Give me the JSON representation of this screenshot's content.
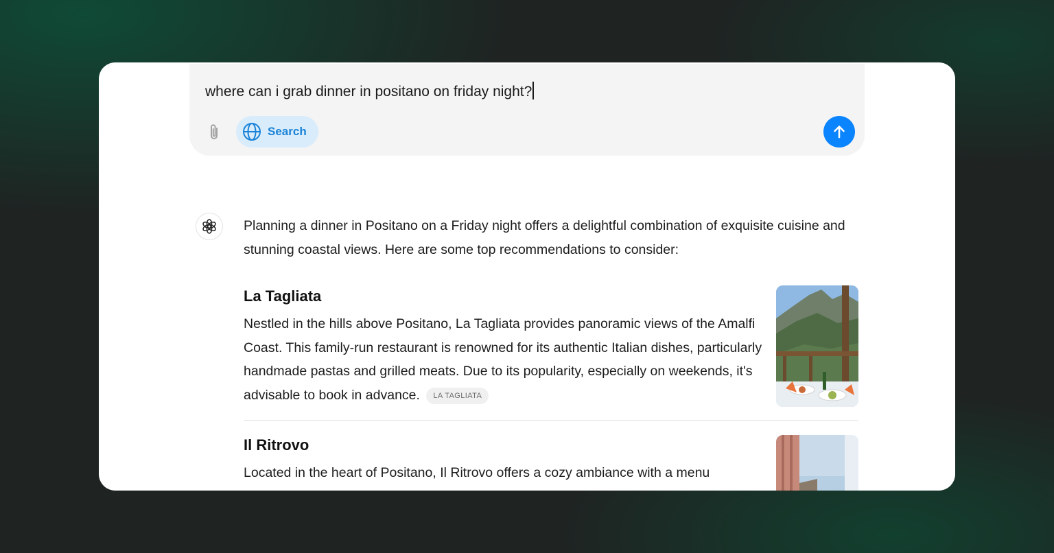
{
  "composer": {
    "query": "where can i grab dinner in positano on friday night?",
    "search_label": "Search"
  },
  "response": {
    "intro": "Planning a dinner in Positano on a Friday night offers a delightful combination of exquisite cuisine and stunning coastal views. Here are some top recommendations to consider:",
    "items": [
      {
        "title": "La Tagliata",
        "body": "Nestled in the hills above Positano, La Tagliata provides panoramic views of the Amalfi Coast. This family-run restaurant is renowned for its authentic Italian dishes, particularly handmade pastas and grilled meats. Due to its popularity, especially on weekends, it's advisable to book in advance.",
        "source": "LA TAGLIATA"
      },
      {
        "title": "Il Ritrovo",
        "body": "Located in the heart of Positano, Il Ritrovo offers a cozy ambiance with a menu"
      }
    ]
  },
  "colors": {
    "accent": "#0a84ff",
    "search_chip_bg": "#d9ecfb",
    "search_chip_text": "#1a83d8"
  },
  "icons": {
    "attach": "paperclip-icon",
    "search": "globe-icon",
    "send": "arrow-up-icon",
    "assistant": "openai-logo-icon"
  }
}
